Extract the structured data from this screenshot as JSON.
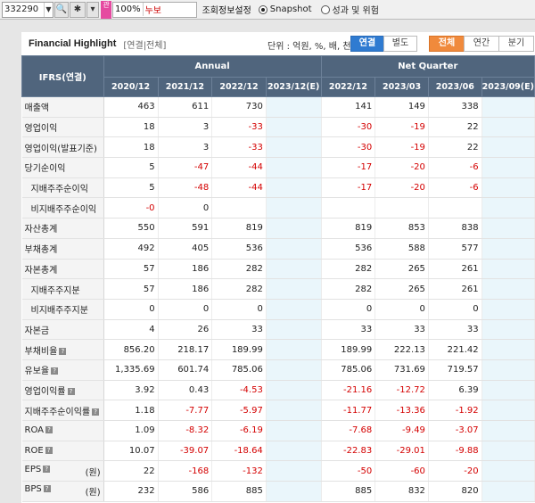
{
  "toolbar": {
    "code": "332290",
    "zoom": "100%",
    "name": "누보",
    "title": "조회정보설정",
    "radio_snapshot": "Snapshot",
    "radio_perf": "성과 및 위험"
  },
  "highlight": {
    "title": "Financial Highlight",
    "subtitle": "[연결|전체]",
    "unit": "단위 : 억원, %, 배, 천주",
    "btn_consol": "연결",
    "btn_separate": "별도",
    "btn_all": "전체",
    "btn_annual": "연간",
    "btn_quarter": "분기"
  },
  "table": {
    "ifrs_header": "IFRS(연결)",
    "group_annual": "Annual",
    "group_quarter": "Net Quarter",
    "columns": [
      "2020/12",
      "2021/12",
      "2022/12",
      "2023/12(E)",
      "2022/12",
      "2023/03",
      "2023/06",
      "2023/09(E)"
    ],
    "rows": [
      {
        "label": "매출액",
        "sub": false,
        "help": false,
        "values": [
          "463",
          "611",
          "730",
          "",
          "141",
          "149",
          "338",
          ""
        ]
      },
      {
        "label": "영업이익",
        "sub": false,
        "help": false,
        "values": [
          "18",
          "3",
          "-33",
          "",
          "-30",
          "-19",
          "22",
          ""
        ]
      },
      {
        "label": "영업이익(발표기준)",
        "sub": false,
        "help": false,
        "values": [
          "18",
          "3",
          "-33",
          "",
          "-30",
          "-19",
          "22",
          ""
        ]
      },
      {
        "label": "당기순이익",
        "sub": false,
        "help": false,
        "values": [
          "5",
          "-47",
          "-44",
          "",
          "-17",
          "-20",
          "-6",
          ""
        ]
      },
      {
        "label": "지배주주순이익",
        "sub": true,
        "help": false,
        "values": [
          "5",
          "-48",
          "-44",
          "",
          "-17",
          "-20",
          "-6",
          ""
        ]
      },
      {
        "label": "비지배주주순이익",
        "sub": true,
        "help": false,
        "values": [
          "-0",
          "0",
          "",
          "",
          "",
          "",
          "",
          ""
        ]
      },
      {
        "label": "자산총계",
        "sub": false,
        "help": false,
        "values": [
          "550",
          "591",
          "819",
          "",
          "819",
          "853",
          "838",
          ""
        ]
      },
      {
        "label": "부채총계",
        "sub": false,
        "help": false,
        "values": [
          "492",
          "405",
          "536",
          "",
          "536",
          "588",
          "577",
          ""
        ]
      },
      {
        "label": "자본총계",
        "sub": false,
        "help": false,
        "values": [
          "57",
          "186",
          "282",
          "",
          "282",
          "265",
          "261",
          ""
        ]
      },
      {
        "label": "지배주주지분",
        "sub": true,
        "help": false,
        "values": [
          "57",
          "186",
          "282",
          "",
          "282",
          "265",
          "261",
          ""
        ]
      },
      {
        "label": "비지배주주지분",
        "sub": true,
        "help": false,
        "values": [
          "0",
          "0",
          "0",
          "",
          "0",
          "0",
          "0",
          ""
        ]
      },
      {
        "label": "자본금",
        "sub": false,
        "help": false,
        "values": [
          "4",
          "26",
          "33",
          "",
          "33",
          "33",
          "33",
          ""
        ]
      },
      {
        "label": "부채비율",
        "sub": false,
        "help": true,
        "values": [
          "856.20",
          "218.17",
          "189.99",
          "",
          "189.99",
          "222.13",
          "221.42",
          ""
        ]
      },
      {
        "label": "유보율",
        "sub": false,
        "help": true,
        "values": [
          "1,335.69",
          "601.74",
          "785.06",
          "",
          "785.06",
          "731.69",
          "719.57",
          ""
        ]
      },
      {
        "label": "영업이익률",
        "sub": false,
        "help": true,
        "values": [
          "3.92",
          "0.43",
          "-4.53",
          "",
          "-21.16",
          "-12.72",
          "6.39",
          ""
        ]
      },
      {
        "label": "지배주주순이익률",
        "sub": false,
        "help": true,
        "values": [
          "1.18",
          "-7.77",
          "-5.97",
          "",
          "-11.77",
          "-13.36",
          "-1.92",
          ""
        ]
      },
      {
        "label": "ROA",
        "sub": false,
        "help": true,
        "values": [
          "1.09",
          "-8.32",
          "-6.19",
          "",
          "-7.68",
          "-9.49",
          "-3.07",
          ""
        ]
      },
      {
        "label": "ROE",
        "sub": false,
        "help": true,
        "values": [
          "10.07",
          "-39.07",
          "-18.64",
          "",
          "-22.83",
          "-29.01",
          "-9.88",
          ""
        ]
      },
      {
        "label": "EPS",
        "sub": false,
        "help": true,
        "won": "(원)",
        "values": [
          "22",
          "-168",
          "-132",
          "",
          "-50",
          "-60",
          "-20",
          ""
        ]
      },
      {
        "label": "BPS",
        "sub": false,
        "help": true,
        "won": "(원)",
        "values": [
          "232",
          "586",
          "885",
          "",
          "885",
          "832",
          "820",
          ""
        ]
      }
    ]
  },
  "colors": {
    "header_bg": "#50657d",
    "estimate_bg": "#eaf6fb",
    "negative": "#d40000",
    "btn_blue": "#2f7bd1",
    "btn_orange": "#f08a3c"
  }
}
